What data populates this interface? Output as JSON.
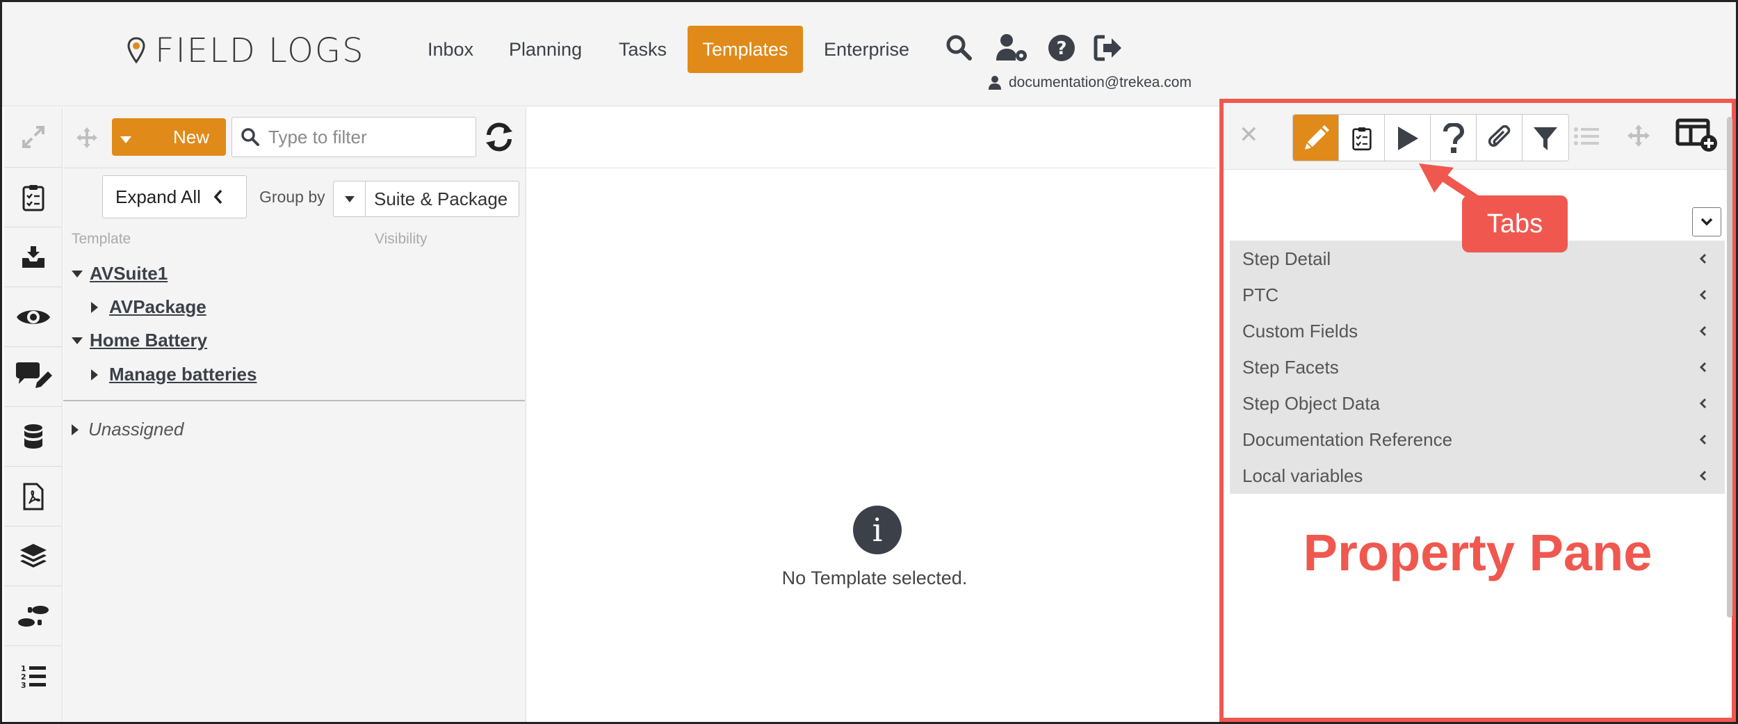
{
  "app": {
    "logo_text": "FIELD LOGS",
    "accent_color": "#e08a1a",
    "annotation_color": "#f0584f"
  },
  "header": {
    "nav": [
      {
        "label": "Inbox",
        "active": false
      },
      {
        "label": "Planning",
        "active": false
      },
      {
        "label": "Tasks",
        "active": false
      },
      {
        "label": "Templates",
        "active": true
      },
      {
        "label": "Enterprise",
        "active": false
      }
    ],
    "icons": [
      "search-icon",
      "user-settings-icon",
      "help-icon",
      "logout-icon"
    ],
    "user_email": "documentation@trekea.com"
  },
  "rail": {
    "icons": [
      "expand-icon",
      "clipboard-checklist-icon",
      "inbox-download-icon",
      "eye-icon",
      "comment-edit-icon",
      "database-icon",
      "pdf-file-icon",
      "layers-icon",
      "footsteps-icon",
      "numbered-list-icon"
    ]
  },
  "tree_panel": {
    "new_label": "New",
    "filter_placeholder": "Type to filter",
    "expand_all_label": "Expand All",
    "group_by_label": "Group by",
    "group_by_value": "Suite & Package",
    "col_template": "Template",
    "col_visibility": "Visibility",
    "nodes": [
      {
        "label": "AVSuite1",
        "level": 0,
        "expanded": true
      },
      {
        "label": "AVPackage",
        "level": 1,
        "expanded": false
      },
      {
        "label": "Home Battery",
        "level": 0,
        "expanded": true
      },
      {
        "label": "Manage batteries",
        "level": 1,
        "expanded": false
      }
    ],
    "unassigned_label": "Unassigned"
  },
  "center": {
    "empty_message": "No Template selected."
  },
  "property_pane": {
    "tabs": [
      "edit-pencil-icon",
      "clipboard-checklist-icon",
      "play-icon",
      "question-icon",
      "paperclip-icon",
      "filter-icon"
    ],
    "active_tab": 0,
    "sections": [
      "Step Detail",
      "PTC",
      "Custom Fields",
      "Step Facets",
      "Step Object Data",
      "Documentation Reference",
      "Local variables"
    ],
    "annotation_title": "Property Pane",
    "callout_label": "Tabs"
  }
}
